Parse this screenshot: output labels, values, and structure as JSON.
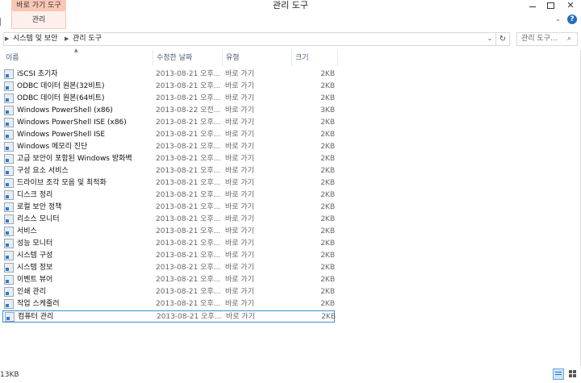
{
  "window": {
    "title": "관리 도구",
    "context_tab_header": "바로 가기 도구",
    "ribbon_tab": "관리",
    "close_glyph": "✕",
    "help_glyph": "?"
  },
  "address": {
    "breadcrumb": [
      "시스템 및 보안",
      "관리 도구"
    ],
    "search_placeholder": "관리 도구..."
  },
  "columns": {
    "name": "이름",
    "date": "수정한 날짜",
    "type": "유형",
    "size": "크기"
  },
  "files": [
    {
      "name": "iSCSI 초기자",
      "date": "2013-08-21 오후...",
      "type": "바로 가기",
      "size": "2KB"
    },
    {
      "name": "ODBC 데이터 원본(32비트)",
      "date": "2013-08-21 오후...",
      "type": "바로 가기",
      "size": "2KB"
    },
    {
      "name": "ODBC 데이터 원본(64비트)",
      "date": "2013-08-21 오후...",
      "type": "바로 가기",
      "size": "2KB"
    },
    {
      "name": "Windows PowerShell (x86)",
      "date": "2013-08-22 오전...",
      "type": "바로 가기",
      "size": "3KB"
    },
    {
      "name": "Windows PowerShell ISE (x86)",
      "date": "2013-08-21 오후...",
      "type": "바로 가기",
      "size": "2KB"
    },
    {
      "name": "Windows PowerShell ISE",
      "date": "2013-08-21 오후...",
      "type": "바로 가기",
      "size": "2KB"
    },
    {
      "name": "Windows 메모리 진단",
      "date": "2013-08-21 오후...",
      "type": "바로 가기",
      "size": "2KB"
    },
    {
      "name": "고급 보안이 포함된 Windows 방화벽",
      "date": "2013-08-21 오후...",
      "type": "바로 가기",
      "size": "2KB"
    },
    {
      "name": "구성 요소 서비스",
      "date": "2013-08-21 오후...",
      "type": "바로 가기",
      "size": "2KB"
    },
    {
      "name": "드라이브 조각 모음 및 최적화",
      "date": "2013-08-21 오후...",
      "type": "바로 가기",
      "size": "2KB"
    },
    {
      "name": "디스크 정리",
      "date": "2013-08-21 오후...",
      "type": "바로 가기",
      "size": "2KB"
    },
    {
      "name": "로컬 보안 정책",
      "date": "2013-08-21 오후...",
      "type": "바로 가기",
      "size": "2KB"
    },
    {
      "name": "리소스 모니터",
      "date": "2013-08-21 오후...",
      "type": "바로 가기",
      "size": "2KB"
    },
    {
      "name": "서비스",
      "date": "2013-08-21 오후...",
      "type": "바로 가기",
      "size": "2KB"
    },
    {
      "name": "성능 모니터",
      "date": "2013-08-21 오후...",
      "type": "바로 가기",
      "size": "2KB"
    },
    {
      "name": "시스템 구성",
      "date": "2013-08-21 오후...",
      "type": "바로 가기",
      "size": "2KB"
    },
    {
      "name": "시스템 정보",
      "date": "2013-08-21 오후...",
      "type": "바로 가기",
      "size": "2KB"
    },
    {
      "name": "이벤트 뷰어",
      "date": "2013-08-21 오후...",
      "type": "바로 가기",
      "size": "2KB"
    },
    {
      "name": "인쇄 관리",
      "date": "2013-08-21 오후...",
      "type": "바로 가기",
      "size": "2KB"
    },
    {
      "name": "작업 스케줄러",
      "date": "2013-08-21 오후...",
      "type": "바로 가기",
      "size": "2KB"
    },
    {
      "name": "컴퓨터 관리",
      "date": "2013-08-21 오후...",
      "type": "바로 가기",
      "size": "2KB",
      "selected": true
    }
  ],
  "status": {
    "text": "13KB"
  },
  "icons": {
    "file": "shortcut-icon",
    "refresh": "refresh-icon",
    "search": "search-icon"
  },
  "colors": {
    "context_tab": "#f9c7b5",
    "selection_border": "#3b8ed8",
    "header_text": "#4c607a"
  }
}
